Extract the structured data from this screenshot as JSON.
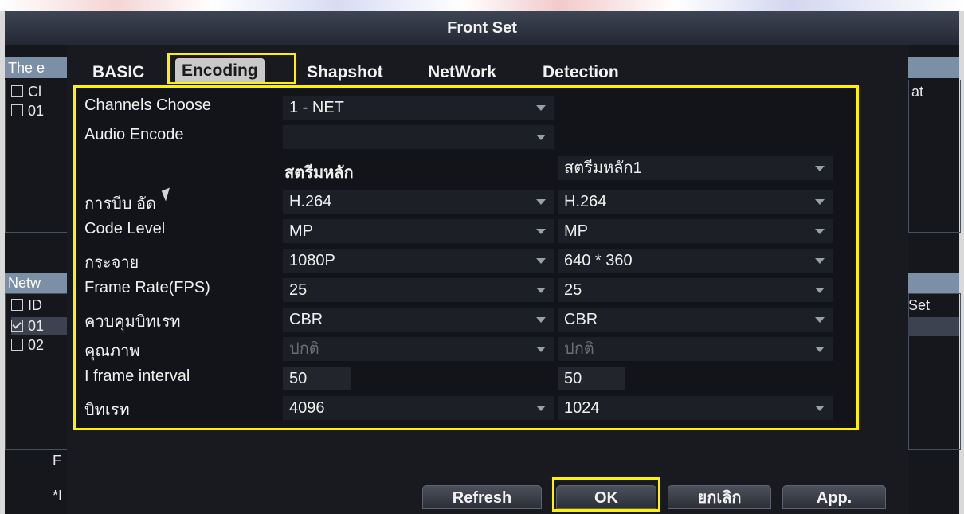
{
  "window": {
    "title": "Front Set"
  },
  "background": {
    "strip_top": "The e",
    "row_ch": "Cl",
    "row_01": "01",
    "strip_mid": "Netw",
    "row_id": "ID",
    "row_01b": "01",
    "row_02": "02",
    "right_text_1": "at",
    "right_text_2": "Set",
    "left_f": "F",
    "left_star": "*I"
  },
  "tabs": [
    {
      "label": "BASIC",
      "active": false
    },
    {
      "label": "Encoding",
      "active": true
    },
    {
      "label": "Shapshot",
      "active": false
    },
    {
      "label": "NetWork",
      "active": false
    },
    {
      "label": "Detection",
      "active": false
    }
  ],
  "form": {
    "channels_choose": {
      "label": "Channels Choose",
      "value": "1 - NET"
    },
    "audio_encode": {
      "label": "Audio Encode",
      "value": ""
    },
    "stream_headers": {
      "main": "สตรีมหลัก",
      "sub": "สตรีมหลัก1"
    },
    "rows": [
      {
        "label": "การบีบ อัด",
        "main": "H.264",
        "sub": "H.264",
        "main_dropdown": true,
        "sub_dropdown": true,
        "dim": false
      },
      {
        "label": "Code Level",
        "main": "MP",
        "sub": "MP",
        "main_dropdown": true,
        "sub_dropdown": true,
        "dim": false
      },
      {
        "label": "กระจาย",
        "main": "1080P",
        "sub": "640 * 360",
        "main_dropdown": true,
        "sub_dropdown": true,
        "dim": false
      },
      {
        "label": "Frame Rate(FPS)",
        "main": "25",
        "sub": "25",
        "main_dropdown": true,
        "sub_dropdown": true,
        "dim": false
      },
      {
        "label": "ควบคุมบิทเรท",
        "main": "CBR",
        "sub": "CBR",
        "main_dropdown": true,
        "sub_dropdown": true,
        "dim": false
      },
      {
        "label": "คุณภาพ",
        "main": "ปกติ",
        "sub": "ปกติ",
        "main_dropdown": true,
        "sub_dropdown": true,
        "dim": true
      },
      {
        "label": "I frame interval",
        "main": "50",
        "sub": "50",
        "main_dropdown": false,
        "sub_dropdown": false,
        "dim": false
      },
      {
        "label": "บิทเรท",
        "main": "4096",
        "sub": "1024",
        "main_dropdown": true,
        "sub_dropdown": true,
        "dim": false
      }
    ]
  },
  "buttons": {
    "refresh": "Refresh",
    "ok": "OK",
    "cancel": "ยกเลิก",
    "apply": "App."
  },
  "colors": {
    "highlight": "#fff200",
    "active_tab": "#c9c9c9",
    "panel": "#131419"
  }
}
